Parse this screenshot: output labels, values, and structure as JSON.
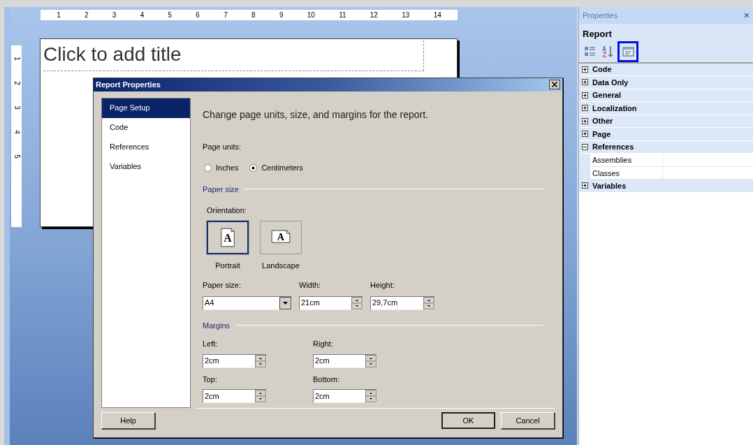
{
  "ruler_horizontal": {
    "ticks": [
      "1",
      "2",
      "3",
      "4",
      "5",
      "6",
      "7",
      "8",
      "9",
      "10",
      "11",
      "12",
      "13",
      "14"
    ]
  },
  "ruler_vertical": {
    "ticks": [
      "1",
      "2",
      "3",
      "4",
      "5"
    ]
  },
  "report": {
    "title_placeholder": "Click to add title"
  },
  "dialog": {
    "title": "Report Properties",
    "nav": [
      {
        "label": "Page Setup",
        "selected": true
      },
      {
        "label": "Code",
        "selected": false
      },
      {
        "label": "References",
        "selected": false
      },
      {
        "label": "Variables",
        "selected": false
      }
    ],
    "heading": "Change page units, size, and margins for the report.",
    "page_units": {
      "label": "Page units:",
      "options": [
        {
          "label": "Inches",
          "selected": false
        },
        {
          "label": "Centimeters",
          "selected": true
        }
      ]
    },
    "paper_size_section": "Paper size",
    "orientation": {
      "label": "Orientation:",
      "options": [
        {
          "label": "Portrait",
          "kind": "portrait",
          "icon_text": "A",
          "selected": true
        },
        {
          "label": "Landscape",
          "kind": "landscape",
          "icon_text": "A",
          "selected": false
        }
      ]
    },
    "paper_fields": [
      {
        "label": "Paper size:",
        "kind": "dropdown",
        "value": "A4"
      },
      {
        "label": "Width:",
        "kind": "spin",
        "value": "21cm"
      },
      {
        "label": "Height:",
        "kind": "spin",
        "value": "29,7cm"
      }
    ],
    "margins_section": "Margins",
    "margins": [
      {
        "label": "Left:",
        "value": "2cm"
      },
      {
        "label": "Right:",
        "value": "2cm"
      },
      {
        "label": "Top:",
        "value": "2cm"
      },
      {
        "label": "Bottom:",
        "value": "2cm"
      }
    ],
    "buttons": {
      "help": "Help",
      "ok": "OK",
      "cancel": "Cancel"
    }
  },
  "properties": {
    "title": "Properties",
    "close": "×",
    "object": "Report",
    "toolbar": [
      {
        "kind": "categorized",
        "selected": false
      },
      {
        "kind": "alphabetical",
        "selected": false
      },
      {
        "kind": "property-pages",
        "selected": true
      }
    ],
    "groups": [
      {
        "name": "Code",
        "expanded": false
      },
      {
        "name": "Data Only",
        "expanded": false
      },
      {
        "name": "General",
        "expanded": false
      },
      {
        "name": "Localization",
        "expanded": false
      },
      {
        "name": "Other",
        "expanded": false
      },
      {
        "name": "Page",
        "expanded": false
      },
      {
        "name": "References",
        "expanded": true,
        "children": [
          {
            "name": "Assemblies"
          },
          {
            "name": "Classes"
          }
        ]
      },
      {
        "name": "Variables",
        "expanded": false
      }
    ]
  }
}
